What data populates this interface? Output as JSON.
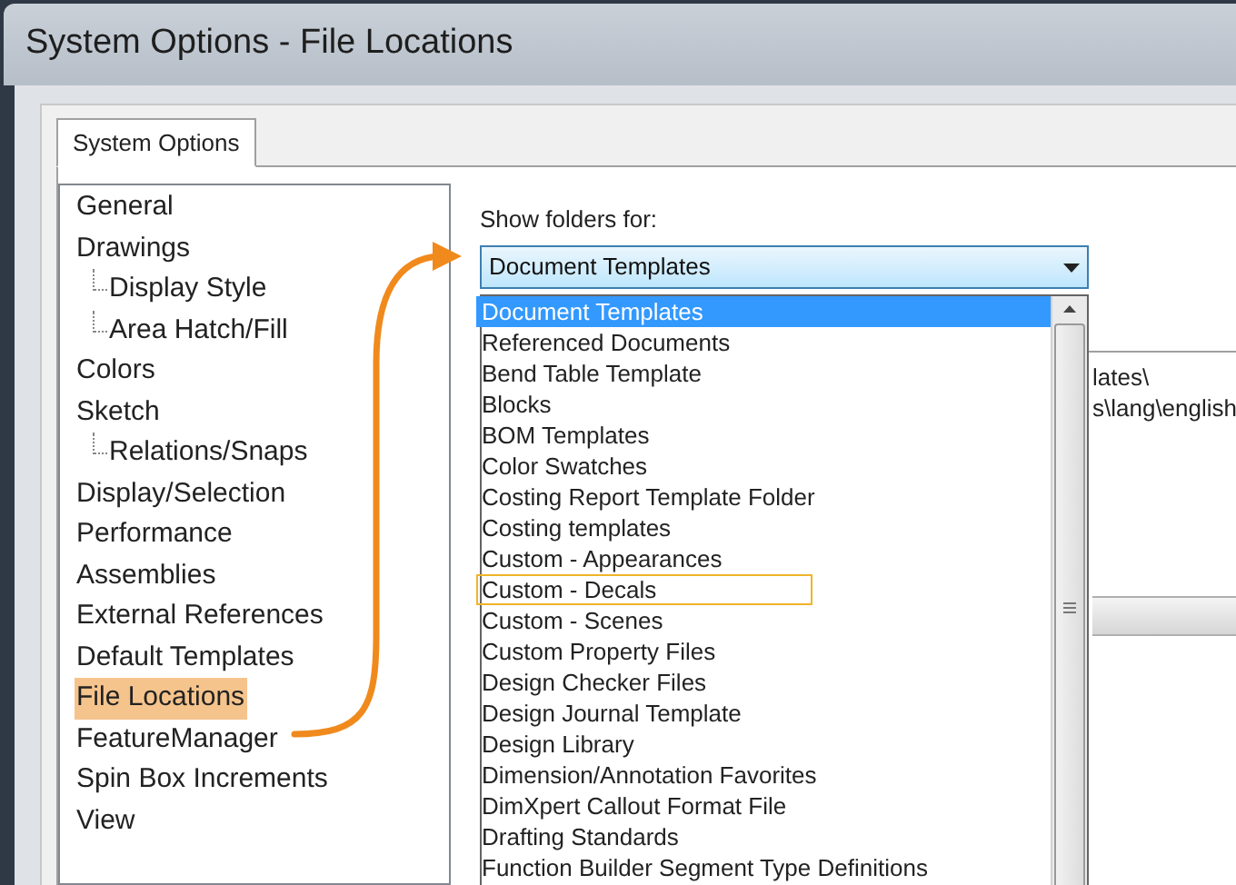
{
  "window": {
    "title": "System Options - File Locations"
  },
  "tabs": [
    {
      "label": "System Options",
      "selected": true
    }
  ],
  "tree": [
    {
      "label": "General",
      "selected": false
    },
    {
      "label": "Drawings",
      "selected": false,
      "children": [
        {
          "label": "Display Style",
          "selected": false
        },
        {
          "label": "Area Hatch/Fill",
          "selected": false
        }
      ]
    },
    {
      "label": "Colors",
      "selected": false
    },
    {
      "label": "Sketch",
      "selected": false,
      "children": [
        {
          "label": "Relations/Snaps",
          "selected": false
        }
      ]
    },
    {
      "label": "Display/Selection",
      "selected": false
    },
    {
      "label": "Performance",
      "selected": false
    },
    {
      "label": "Assemblies",
      "selected": false
    },
    {
      "label": "External References",
      "selected": false
    },
    {
      "label": "Default Templates",
      "selected": false
    },
    {
      "label": "File Locations",
      "selected": true
    },
    {
      "label": "FeatureManager",
      "selected": false
    },
    {
      "label": "Spin Box Increments",
      "selected": false
    },
    {
      "label": "View",
      "selected": false
    }
  ],
  "show_folders": {
    "label": "Show folders for:",
    "value": "Document Templates",
    "options": [
      {
        "label": "Document Templates",
        "selected": true,
        "outlined": false
      },
      {
        "label": "Referenced Documents",
        "selected": false,
        "outlined": false
      },
      {
        "label": "Bend Table Template",
        "selected": false,
        "outlined": false
      },
      {
        "label": "Blocks",
        "selected": false,
        "outlined": false
      },
      {
        "label": "BOM Templates",
        "selected": false,
        "outlined": false
      },
      {
        "label": "Color Swatches",
        "selected": false,
        "outlined": false
      },
      {
        "label": "Costing Report Template Folder",
        "selected": false,
        "outlined": false
      },
      {
        "label": "Costing templates",
        "selected": false,
        "outlined": false
      },
      {
        "label": "Custom - Appearances",
        "selected": false,
        "outlined": false
      },
      {
        "label": "Custom - Decals",
        "selected": false,
        "outlined": true
      },
      {
        "label": "Custom - Scenes",
        "selected": false,
        "outlined": false
      },
      {
        "label": "Custom Property Files",
        "selected": false,
        "outlined": false
      },
      {
        "label": "Design Checker Files",
        "selected": false,
        "outlined": false
      },
      {
        "label": "Design Journal Template",
        "selected": false,
        "outlined": false
      },
      {
        "label": "Design Library",
        "selected": false,
        "outlined": false
      },
      {
        "label": "Dimension/Annotation Favorites",
        "selected": false,
        "outlined": false
      },
      {
        "label": "DimXpert Callout Format File",
        "selected": false,
        "outlined": false
      },
      {
        "label": "Drafting Standards",
        "selected": false,
        "outlined": false
      },
      {
        "label": "Function Builder Segment Type Definitions",
        "selected": false,
        "outlined": false
      }
    ]
  },
  "folder_paths": [
    "lates\\",
    "s\\lang\\english"
  ]
}
